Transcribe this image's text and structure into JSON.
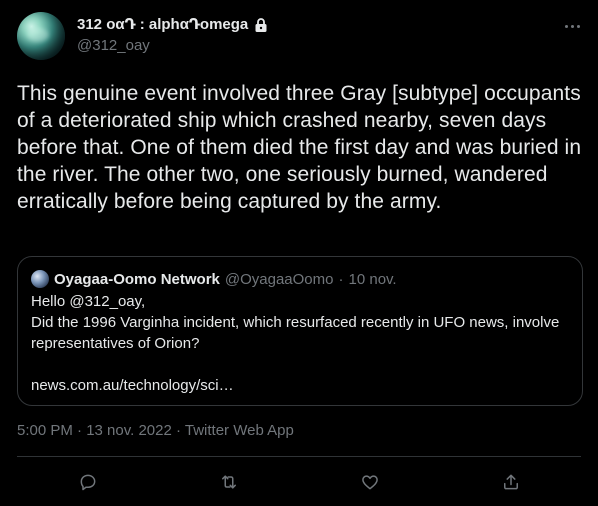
{
  "author": {
    "display_name": "312 οαԴ : alphαԴomega",
    "handle": "@312_oay",
    "protected": true
  },
  "tweet": {
    "text": "This genuine event involved three Gray [subtype] occupants of a deteriorated ship which crashed nearby, seven days before that. One of them died the first day and was buried in the river. The other two, one seriously burned, wandered erratically before being captured by the army."
  },
  "quote": {
    "name": "Oyagaa-Oomo Network",
    "handle": "@OyagaaOomo",
    "separator": "·",
    "date": "10 nov.",
    "lines": [
      "Hello @312_oay,",
      "Did the 1996 Varginha incident, which resurfaced recently in UFO news, involve",
      "representatives of Orion?"
    ],
    "link": "news.com.au/technology/sci…"
  },
  "meta": {
    "text": "5:00 PM · 13 nov. 2022 · Twitter Web App"
  },
  "actions": {
    "reply": "reply-icon",
    "retweet": "retweet-icon",
    "like": "heart-icon",
    "share": "share-icon"
  },
  "colors": {
    "background": "#000000",
    "text": "#e7e9ea",
    "muted": "#71767b",
    "border": "#333639"
  }
}
